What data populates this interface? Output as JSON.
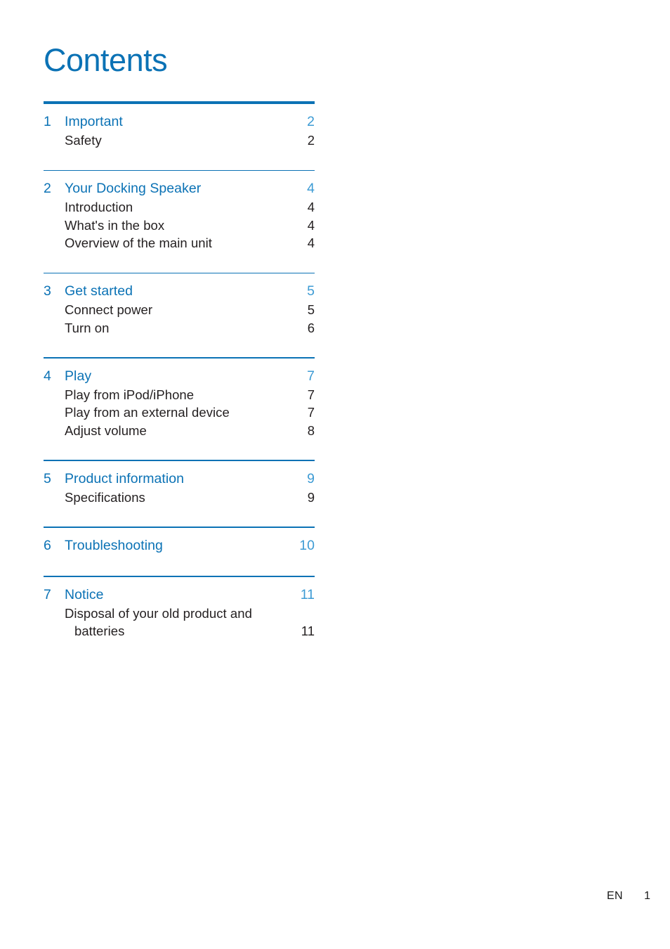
{
  "document": {
    "title": "Contents",
    "accent_color": "#0b72b5",
    "page_number_color": "#3d9bd4",
    "body_text_color": "#231f20"
  },
  "toc": {
    "sections": [
      {
        "number": "1",
        "title": "Important",
        "page": "2",
        "entries": [
          {
            "label": "Safety",
            "page": "2"
          }
        ]
      },
      {
        "number": "2",
        "title": "Your Docking Speaker",
        "page": "4",
        "entries": [
          {
            "label": "Introduction",
            "page": "4"
          },
          {
            "label": "What's in the box",
            "page": "4"
          },
          {
            "label": "Overview of the main unit",
            "page": "4"
          }
        ]
      },
      {
        "number": "3",
        "title": "Get started",
        "page": "5",
        "entries": [
          {
            "label": "Connect power",
            "page": "5"
          },
          {
            "label": "Turn on",
            "page": "6"
          }
        ]
      },
      {
        "number": "4",
        "title": "Play",
        "page": "7",
        "entries": [
          {
            "label": "Play from iPod/iPhone",
            "page": "7"
          },
          {
            "label": "Play from an external device",
            "page": "7"
          },
          {
            "label": "Adjust volume",
            "page": "8"
          }
        ]
      },
      {
        "number": "5",
        "title": "Product information",
        "page": "9",
        "entries": [
          {
            "label": "Specifications",
            "page": "9"
          }
        ]
      },
      {
        "number": "6",
        "title": "Troubleshooting",
        "page": "10",
        "entries": []
      },
      {
        "number": "7",
        "title": "Notice",
        "page": "11",
        "entries": [
          {
            "label_line1": "Disposal of your old product and",
            "label_line2": "batteries",
            "page": "11"
          }
        ]
      }
    ]
  },
  "footer": {
    "language": "EN",
    "page": "1"
  }
}
